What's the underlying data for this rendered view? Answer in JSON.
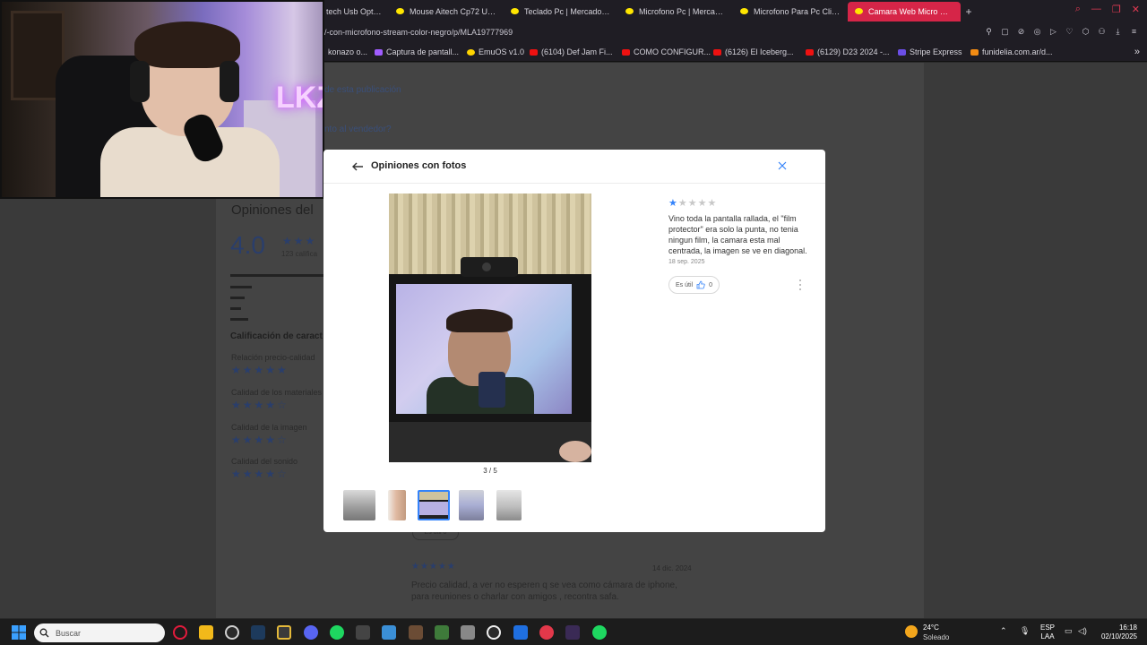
{
  "browser": {
    "tabs": [
      {
        "label": "tech Usb Optico",
        "active": false
      },
      {
        "label": "Mouse Aitech Cp72 Usb Optico",
        "active": false
      },
      {
        "label": "Teclado Pc | MercadoLibre",
        "active": false
      },
      {
        "label": "Microfono Pc | MercadoLibre",
        "active": false
      },
      {
        "label": "Microfono Para Pc Clip Con",
        "active": false
      },
      {
        "label": "Camara Web Micro C721",
        "active": true
      }
    ],
    "url": "/-con-microfono-stream-color-negro/p/MLA19777969",
    "bookmarks": [
      {
        "label": "konazo o...",
        "icon": "yt"
      },
      {
        "label": "Captura de pantall...",
        "icon": "pen"
      },
      {
        "label": "EmuOS v1.0",
        "icon": "y"
      },
      {
        "label": "(6104) Def Jam Fi...",
        "icon": "yt"
      },
      {
        "label": "COMO CONFIGUR...",
        "icon": "yt"
      },
      {
        "label": "(6126) El Iceberg...",
        "icon": "yt"
      },
      {
        "label": "(6129) D23 2024 -...",
        "icon": "yt"
      },
      {
        "label": "Stripe Express",
        "icon": "p"
      },
      {
        "label": "funidelia.com.ar/d...",
        "icon": "o"
      }
    ]
  },
  "background_page": {
    "link_1": "de esta publicación",
    "link_2": "nto al vendedor?",
    "title": "Opiniones del",
    "rating": "4.0",
    "stars": "★★★",
    "count": "123 califica",
    "features_heading": "Calificación de caract",
    "features": [
      {
        "label": "Relación precio-calidad",
        "stars": "★★★★★"
      },
      {
        "label": "Calidad de los materiales",
        "stars": "★★★★☆"
      },
      {
        "label": "Calidad de la imagen",
        "stars": "★★★★☆"
      },
      {
        "label": "Calidad del sonido",
        "stars": "★★★★☆"
      }
    ],
    "review_stars": "★★★★★",
    "review_date": "14 dic. 2024",
    "review_text": "Precio calidad, a ver no esperen q se vea como cámara de iphone, para reuniones o charlar con amigos , recontra safa.",
    "useful_label": "Es útil 0"
  },
  "webcam_overlay": {
    "neon_sign": "LKZ"
  },
  "modal": {
    "title": "Opiniones con fotos",
    "photo_counter": "3 / 5",
    "selected_thumbnail": 3,
    "thumbnail_count": 5,
    "review": {
      "rating": 1,
      "max_rating": 5,
      "text": "Vino toda la pantalla rallada, el \"film protector\" era solo la punta, no tenia ningun film, la camara esta mal centrada, la imagen se ve en diagonal.",
      "date": "18 sep. 2025",
      "useful_label": "Es útil",
      "useful_count": "0"
    },
    "colors": {
      "accent": "#3483fa",
      "star_off": "#c8c8c8"
    }
  },
  "taskbar": {
    "search_placeholder": "Buscar",
    "weather": {
      "temp": "24°C",
      "desc": "Soleado"
    },
    "language": {
      "line1": "ESP",
      "line2": "LAA"
    },
    "clock": {
      "time": "16:18",
      "date": "02/10/2025"
    }
  }
}
